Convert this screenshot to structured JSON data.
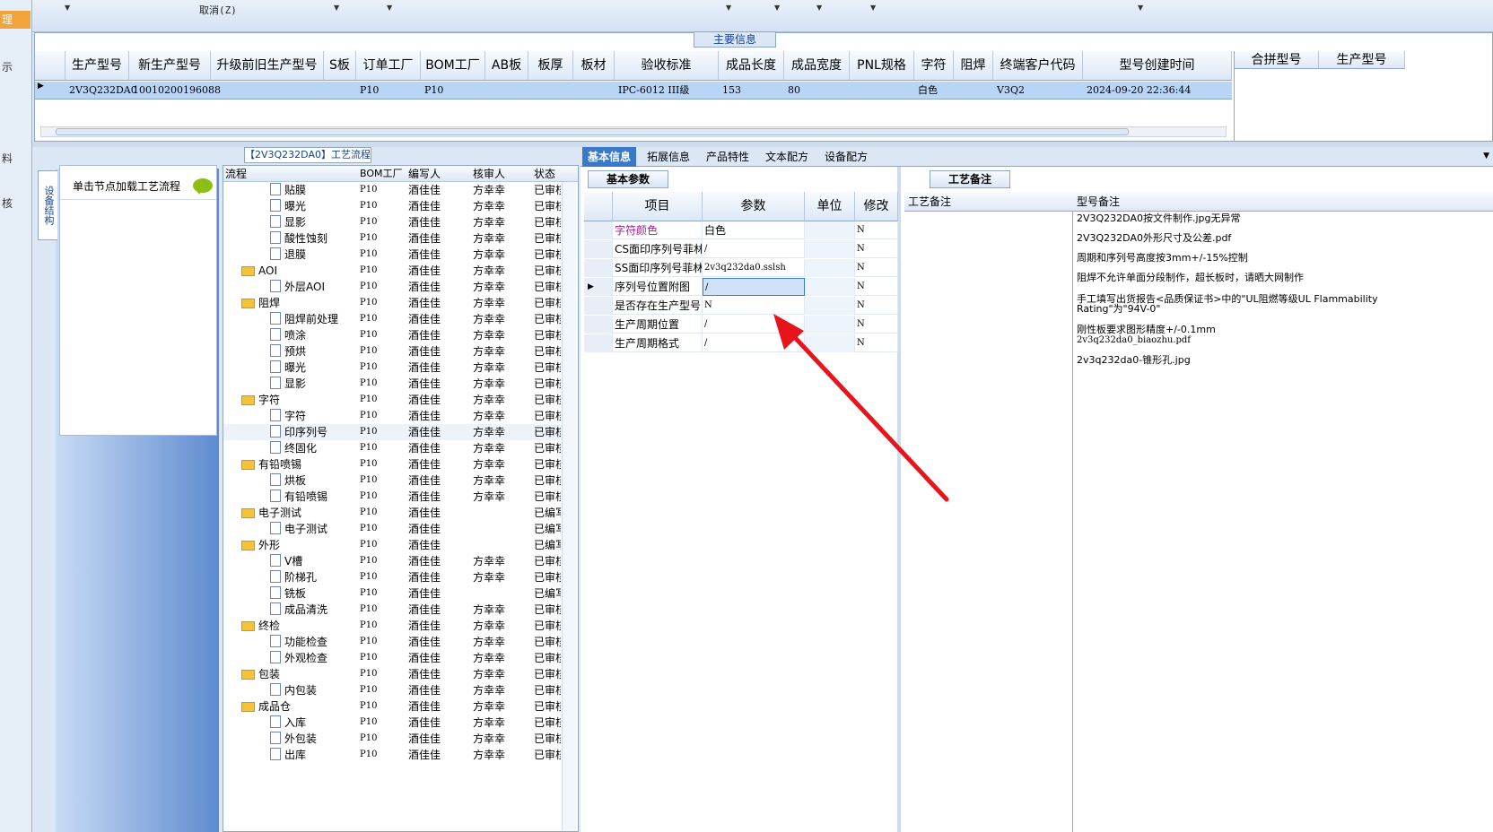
{
  "left_strip": {
    "tag": "理",
    "items": [
      "示",
      "料",
      "核"
    ]
  },
  "toolbar": {
    "cancel_label": "取消(Z)"
  },
  "main_panel": {
    "caption": "主要信息",
    "columns": [
      "生产型号",
      "新生产型号",
      "升级前旧生产型号",
      "S板",
      "订单工厂",
      "BOM工厂",
      "AB板",
      "板厚",
      "板材",
      "验收标准",
      "成品长度",
      "成品宽度",
      "PNL规格",
      "字符",
      "阻焊",
      "终端客户代码",
      "型号创建时间"
    ],
    "extra_columns": [
      "合拼型号",
      "生产型号"
    ],
    "row": {
      "生产型号": "2V3Q232DA0",
      "新生产型号": "10010200196088",
      "订单工厂": "P10",
      "BOM工厂": "P10",
      "验收标准": "IPC-6012 III级",
      "成品长度": "153",
      "成品宽度": "80",
      "字符": "白色",
      "终端客户代码": "V3Q2",
      "型号创建时间": "2024-09-20 22:36:44"
    }
  },
  "process_panel": {
    "caption": "【2V3Q232DA0】工艺流程",
    "vertical_tab": "设备结构",
    "load_hint": "单击节点加载工艺流程",
    "headers": [
      "流程",
      "BOM工厂",
      "编写人",
      "核审人",
      "状态"
    ],
    "rows": [
      {
        "name": "贴膜",
        "level": 1,
        "factory": "P10",
        "author": "酒佳佳",
        "reviewer": "方幸幸",
        "status": "已审核"
      },
      {
        "name": "曝光",
        "level": 1,
        "factory": "P10",
        "author": "酒佳佳",
        "reviewer": "方幸幸",
        "status": "已审核"
      },
      {
        "name": "显影",
        "level": 1,
        "factory": "P10",
        "author": "酒佳佳",
        "reviewer": "方幸幸",
        "status": "已审核"
      },
      {
        "name": "酸性蚀刻",
        "level": 1,
        "factory": "P10",
        "author": "酒佳佳",
        "reviewer": "方幸幸",
        "status": "已审核"
      },
      {
        "name": "退膜",
        "level": 1,
        "factory": "P10",
        "author": "酒佳佳",
        "reviewer": "方幸幸",
        "status": "已审核"
      },
      {
        "name": "AOI",
        "level": 0,
        "factory": "P10",
        "author": "酒佳佳",
        "reviewer": "方幸幸",
        "status": "已审核"
      },
      {
        "name": "外层AOI",
        "level": 1,
        "factory": "P10",
        "author": "酒佳佳",
        "reviewer": "方幸幸",
        "status": "已审核"
      },
      {
        "name": "阻焊",
        "level": 0,
        "factory": "P10",
        "author": "酒佳佳",
        "reviewer": "方幸幸",
        "status": "已审核"
      },
      {
        "name": "阻焊前处理",
        "level": 1,
        "factory": "P10",
        "author": "酒佳佳",
        "reviewer": "方幸幸",
        "status": "已审核"
      },
      {
        "name": "喷涂",
        "level": 1,
        "factory": "P10",
        "author": "酒佳佳",
        "reviewer": "方幸幸",
        "status": "已审核"
      },
      {
        "name": "预烘",
        "level": 1,
        "factory": "P10",
        "author": "酒佳佳",
        "reviewer": "方幸幸",
        "status": "已审核"
      },
      {
        "name": "曝光",
        "level": 1,
        "factory": "P10",
        "author": "酒佳佳",
        "reviewer": "方幸幸",
        "status": "已审核"
      },
      {
        "name": "显影",
        "level": 1,
        "factory": "P10",
        "author": "酒佳佳",
        "reviewer": "方幸幸",
        "status": "已审核"
      },
      {
        "name": "字符",
        "level": 0,
        "factory": "P10",
        "author": "酒佳佳",
        "reviewer": "方幸幸",
        "status": "已审核"
      },
      {
        "name": "字符",
        "level": 1,
        "factory": "P10",
        "author": "酒佳佳",
        "reviewer": "方幸幸",
        "status": "已审核"
      },
      {
        "name": "印序列号",
        "level": 1,
        "factory": "P10",
        "author": "酒佳佳",
        "reviewer": "方幸幸",
        "status": "已审核",
        "selected": true
      },
      {
        "name": "终固化",
        "level": 1,
        "factory": "P10",
        "author": "酒佳佳",
        "reviewer": "方幸幸",
        "status": "已审核"
      },
      {
        "name": "有铅喷锡",
        "level": 0,
        "factory": "P10",
        "author": "酒佳佳",
        "reviewer": "方幸幸",
        "status": "已审核"
      },
      {
        "name": "烘板",
        "level": 1,
        "factory": "P10",
        "author": "酒佳佳",
        "reviewer": "方幸幸",
        "status": "已审核"
      },
      {
        "name": "有铅喷锡",
        "level": 1,
        "factory": "P10",
        "author": "酒佳佳",
        "reviewer": "方幸幸",
        "status": "已审核"
      },
      {
        "name": "电子测试",
        "level": 0,
        "factory": "P10",
        "author": "酒佳佳",
        "reviewer": "",
        "status": "已编写"
      },
      {
        "name": "电子测试",
        "level": 1,
        "factory": "P10",
        "author": "酒佳佳",
        "reviewer": "",
        "status": "已编写"
      },
      {
        "name": "外形",
        "level": 0,
        "factory": "P10",
        "author": "酒佳佳",
        "reviewer": "",
        "status": "已编写"
      },
      {
        "name": "V槽",
        "level": 1,
        "factory": "P10",
        "author": "酒佳佳",
        "reviewer": "方幸幸",
        "status": "已审核"
      },
      {
        "name": "阶梯孔",
        "level": 1,
        "factory": "P10",
        "author": "酒佳佳",
        "reviewer": "方幸幸",
        "status": "已审核"
      },
      {
        "name": "铣板",
        "level": 1,
        "factory": "P10",
        "author": "酒佳佳",
        "reviewer": "",
        "status": "已编写"
      },
      {
        "name": "成品清洗",
        "level": 1,
        "factory": "P10",
        "author": "酒佳佳",
        "reviewer": "方幸幸",
        "status": "已审核"
      },
      {
        "name": "终检",
        "level": 0,
        "factory": "P10",
        "author": "酒佳佳",
        "reviewer": "方幸幸",
        "status": "已审核"
      },
      {
        "name": "功能检查",
        "level": 1,
        "factory": "P10",
        "author": "酒佳佳",
        "reviewer": "方幸幸",
        "status": "已审核"
      },
      {
        "name": "外观检查",
        "level": 1,
        "factory": "P10",
        "author": "酒佳佳",
        "reviewer": "方幸幸",
        "status": "已审核"
      },
      {
        "name": "包装",
        "level": 0,
        "factory": "P10",
        "author": "酒佳佳",
        "reviewer": "方幸幸",
        "status": "已审核"
      },
      {
        "name": "内包装",
        "level": 1,
        "factory": "P10",
        "author": "酒佳佳",
        "reviewer": "方幸幸",
        "status": "已审核"
      },
      {
        "name": "成品仓",
        "level": 0,
        "factory": "P10",
        "author": "酒佳佳",
        "reviewer": "方幸幸",
        "status": "已审核"
      },
      {
        "name": "入库",
        "level": 1,
        "factory": "P10",
        "author": "酒佳佳",
        "reviewer": "方幸幸",
        "status": "已审核"
      },
      {
        "name": "外包装",
        "level": 1,
        "factory": "P10",
        "author": "酒佳佳",
        "reviewer": "方幸幸",
        "status": "已审核"
      },
      {
        "name": "出库",
        "level": 1,
        "factory": "P10",
        "author": "酒佳佳",
        "reviewer": "方幸幸",
        "status": "已审核"
      }
    ]
  },
  "tabs": [
    "基本信息",
    "拓展信息",
    "产品特性",
    "文本配方",
    "设备配方"
  ],
  "basic_params": {
    "caption": "基本参数",
    "headers": [
      "项目",
      "参数",
      "单位",
      "修改"
    ],
    "rows": [
      {
        "item": "字符颜色",
        "value": "白色",
        "unit": "",
        "modified": "N",
        "highlight": true
      },
      {
        "item": "CS面印序列号菲林",
        "value": "/",
        "unit": "",
        "modified": "N"
      },
      {
        "item": "SS面印序列号菲林",
        "value": "2v3q232da0.sslsh",
        "unit": "",
        "modified": "N"
      },
      {
        "item": "序列号位置附图",
        "value": "/",
        "unit": "",
        "modified": "N",
        "selected": true
      },
      {
        "item": "是否存在生产型号",
        "value": "N",
        "unit": "",
        "modified": "N"
      },
      {
        "item": "生产周期位置",
        "value": "/",
        "unit": "",
        "modified": "N"
      },
      {
        "item": "生产周期格式",
        "value": "/",
        "unit": "",
        "modified": "N"
      }
    ]
  },
  "remarks": {
    "caption": "工艺备注",
    "headers": [
      "工艺备注",
      "型号备注"
    ],
    "items": [
      "2V3Q232DA0按文件制作.jpg无异常",
      "2V3Q232DA0外形尺寸及公差.pdf",
      "周期和序列号高度按3mm+/-15%控制",
      "阻焊不允许单面分段制作，超长板时，请晒大网制作",
      "手工填写出货报告<品质保证书>中的\"UL阻燃等级UL Flammability Rating\"为\"94V-0\"",
      "刚性板要求图形精度+/-0.1mm",
      "2v3q232da0_biaozhu.pdf",
      "2v3q232da0-锥形孔.jpg"
    ]
  },
  "colors": {
    "accent": "#3a78c9",
    "selected_row": "#b9d5f6",
    "arrow": "#e8141b",
    "highlight_text": "#a0218f"
  }
}
